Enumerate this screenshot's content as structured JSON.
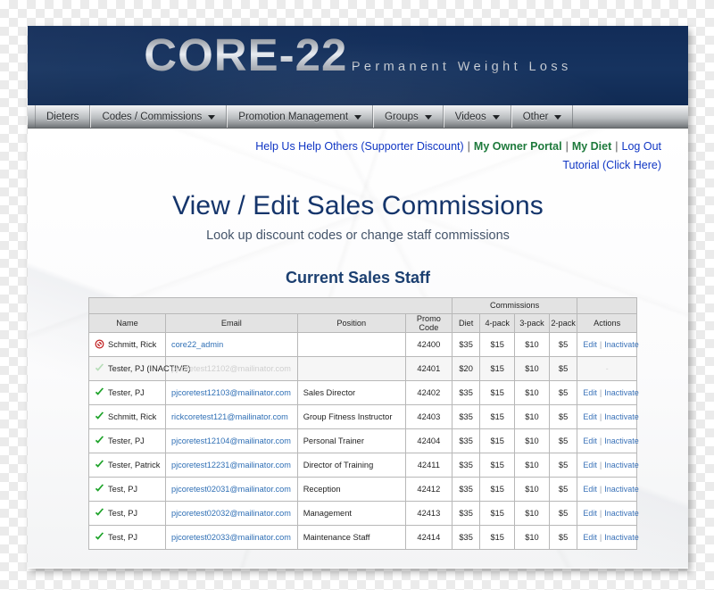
{
  "brand": {
    "logo_main": "CORE-22",
    "logo_sub": "Permanent Weight Loss",
    "header_color": "#15305e",
    "accent_blue": "#1036c4",
    "accent_green": "#1e7a3c",
    "link_blue": "#3a72b8"
  },
  "nav": {
    "items": [
      {
        "label": "Dieters",
        "has_caret": false
      },
      {
        "label": "Codes / Commissions",
        "has_caret": true
      },
      {
        "label": "Promotion Management",
        "has_caret": true
      },
      {
        "label": "Groups",
        "has_caret": true
      },
      {
        "label": "Videos",
        "has_caret": true
      },
      {
        "label": "Other",
        "has_caret": true
      }
    ]
  },
  "utility_links": {
    "row1": [
      {
        "label": "Help Us Help Others (Supporter Discount)",
        "style": "normal"
      },
      {
        "label": "My Owner Portal",
        "style": "strong"
      },
      {
        "label": "My Diet",
        "style": "strong"
      },
      {
        "label": "Log Out",
        "style": "normal"
      }
    ],
    "separator": "|",
    "row2": {
      "label": "Tutorial (Click Here)"
    }
  },
  "page": {
    "title": "View / Edit Sales Commissions",
    "subtitle": "Look up discount codes or change staff commissions",
    "section_title": "Current Sales Staff"
  },
  "table": {
    "group_header": "Commissions",
    "columns": [
      "Name",
      "Email",
      "Position",
      "Promo Code",
      "Diet",
      "4-pack",
      "3-pack",
      "2-pack",
      "Actions"
    ],
    "actions": {
      "edit": "Edit",
      "inactivate": "Inactivate",
      "separator": "|",
      "none": "-"
    },
    "icons": {
      "active": "check-icon",
      "blocked": "block-icon"
    },
    "rows": [
      {
        "status_icon": "block-icon",
        "name": "Schmitt, Rick",
        "email": "core22_admin",
        "position": "",
        "promo_code": "42400",
        "diet": "$35",
        "pack4": "$15",
        "pack3": "$10",
        "pack2": "$5",
        "inactive": false,
        "has_actions": true
      },
      {
        "status_icon": "check-icon",
        "name": "Tester, PJ (INACTIVE)",
        "email": "pjcoretest12102@mailinator.com",
        "position": "",
        "promo_code": "42401",
        "diet": "$20",
        "pack4": "$15",
        "pack3": "$10",
        "pack2": "$5",
        "inactive": true,
        "has_actions": false
      },
      {
        "status_icon": "check-icon",
        "name": "Tester, PJ",
        "email": "pjcoretest12103@mailinator.com",
        "position": "Sales Director",
        "promo_code": "42402",
        "diet": "$35",
        "pack4": "$15",
        "pack3": "$10",
        "pack2": "$5",
        "inactive": false,
        "has_actions": true
      },
      {
        "status_icon": "check-icon",
        "name": "Schmitt, Rick",
        "email": "rickcoretest121@mailinator.com",
        "position": "Group Fitness Instructor",
        "promo_code": "42403",
        "diet": "$35",
        "pack4": "$15",
        "pack3": "$10",
        "pack2": "$5",
        "inactive": false,
        "has_actions": true
      },
      {
        "status_icon": "check-icon",
        "name": "Tester, PJ",
        "email": "pjcoretest12104@mailinator.com",
        "position": "Personal Trainer",
        "promo_code": "42404",
        "diet": "$35",
        "pack4": "$15",
        "pack3": "$10",
        "pack2": "$5",
        "inactive": false,
        "has_actions": true
      },
      {
        "status_icon": "check-icon",
        "name": "Tester, Patrick",
        "email": "pjcoretest12231@mailinator.com",
        "position": "Director of Training",
        "promo_code": "42411",
        "diet": "$35",
        "pack4": "$15",
        "pack3": "$10",
        "pack2": "$5",
        "inactive": false,
        "has_actions": true
      },
      {
        "status_icon": "check-icon",
        "name": "Test, PJ",
        "email": "pjcoretest02031@mailinator.com",
        "position": "Reception",
        "promo_code": "42412",
        "diet": "$35",
        "pack4": "$15",
        "pack3": "$10",
        "pack2": "$5",
        "inactive": false,
        "has_actions": true
      },
      {
        "status_icon": "check-icon",
        "name": "Test, PJ",
        "email": "pjcoretest02032@mailinator.com",
        "position": "Management",
        "promo_code": "42413",
        "diet": "$35",
        "pack4": "$15",
        "pack3": "$10",
        "pack2": "$5",
        "inactive": false,
        "has_actions": true
      },
      {
        "status_icon": "check-icon",
        "name": "Test, PJ",
        "email": "pjcoretest02033@mailinator.com",
        "position": "Maintenance Staff",
        "promo_code": "42414",
        "diet": "$35",
        "pack4": "$15",
        "pack3": "$10",
        "pack2": "$5",
        "inactive": false,
        "has_actions": true
      }
    ]
  }
}
